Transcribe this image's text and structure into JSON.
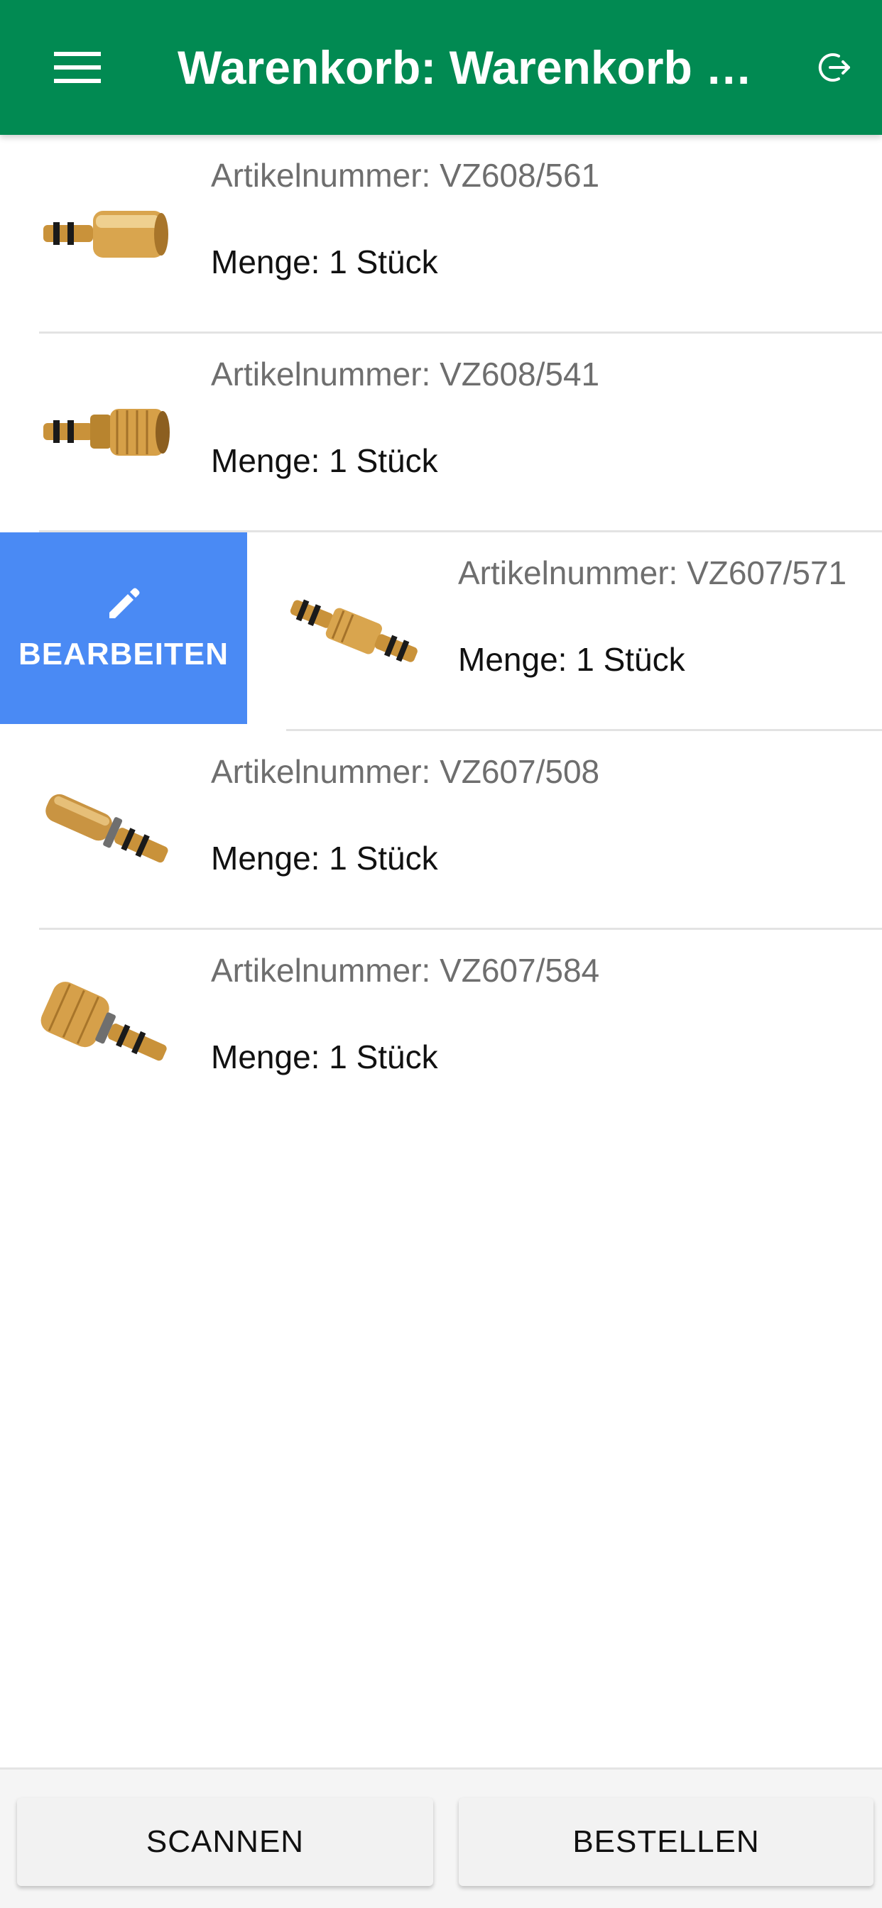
{
  "header": {
    "title": "Warenkorb: Warenkorb al...",
    "menu_icon": "hamburger-menu-icon",
    "logout_icon": "logout-icon"
  },
  "items": [
    {
      "article": "Artikelnummer: VZ608/561",
      "quantity": "Menge: 1 Stück"
    },
    {
      "article": "Artikelnummer: VZ608/541",
      "quantity": "Menge: 1 Stück"
    },
    {
      "article": "Artikelnummer: VZ607/571",
      "quantity": "Menge: 1 Stück"
    },
    {
      "article": "Artikelnummer: VZ607/508",
      "quantity": "Menge: 1 Stück"
    },
    {
      "article": "Artikelnummer: VZ607/584",
      "quantity": "Menge: 1 Stück"
    }
  ],
  "swipe_action": {
    "label": "BEARBEITEN",
    "icon": "pencil-icon"
  },
  "footer": {
    "scan_label": "SCANNEN",
    "order_label": "BESTELLEN"
  },
  "colors": {
    "appbar": "#018a52",
    "edit_action": "#4a8af4"
  }
}
